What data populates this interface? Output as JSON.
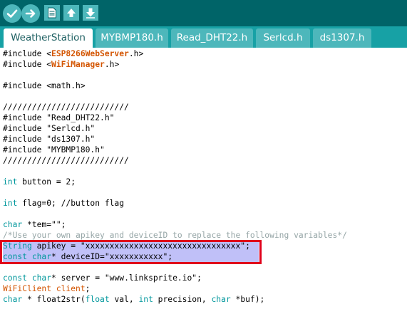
{
  "toolbar": {
    "buttons": [
      {
        "name": "verify-button",
        "icon": "checkmark-icon"
      },
      {
        "name": "upload-button",
        "icon": "arrow-right-icon"
      },
      {
        "name": "new-button",
        "icon": "document-icon"
      },
      {
        "name": "open-button",
        "icon": "arrow-up-icon"
      },
      {
        "name": "save-button",
        "icon": "arrow-down-icon"
      }
    ],
    "colors": {
      "bar": "#006468",
      "button": "#4db7bb"
    }
  },
  "tabs": [
    {
      "label": "WeatherStation",
      "active": true
    },
    {
      "label": "MYBMP180.h",
      "active": false
    },
    {
      "label": "Read_DHT22.h",
      "active": false
    },
    {
      "label": "Serlcd.h",
      "active": false
    },
    {
      "label": "ds1307.h",
      "active": false
    }
  ],
  "code": {
    "lines": [
      {
        "parts": [
          {
            "t": "#include <",
            "c": "plain"
          },
          {
            "t": "ESP8266WebServer",
            "c": "lib"
          },
          {
            "t": ".h>",
            "c": "plain"
          }
        ]
      },
      {
        "parts": [
          {
            "t": "#include <",
            "c": "plain"
          },
          {
            "t": "WiFiManager",
            "c": "lib"
          },
          {
            "t": ".h>",
            "c": "plain"
          }
        ]
      },
      {
        "parts": []
      },
      {
        "parts": [
          {
            "t": "#include <math.h>",
            "c": "plain"
          }
        ]
      },
      {
        "parts": []
      },
      {
        "parts": [
          {
            "t": "//////////////////////////",
            "c": "plain"
          }
        ]
      },
      {
        "parts": [
          {
            "t": "#include \"Read_DHT22.h\"",
            "c": "plain"
          }
        ]
      },
      {
        "parts": [
          {
            "t": "#include \"Serlcd.h\"",
            "c": "plain"
          }
        ]
      },
      {
        "parts": [
          {
            "t": "#include \"ds1307.h\"",
            "c": "plain"
          }
        ]
      },
      {
        "parts": [
          {
            "t": "#include \"MYBMP180.h\"",
            "c": "plain"
          }
        ]
      },
      {
        "parts": [
          {
            "t": "//////////////////////////",
            "c": "plain"
          }
        ]
      },
      {
        "parts": []
      },
      {
        "parts": [
          {
            "t": "int",
            "c": "kw"
          },
          {
            "t": " button = 2;",
            "c": "plain"
          }
        ]
      },
      {
        "parts": []
      },
      {
        "parts": [
          {
            "t": "int",
            "c": "kw"
          },
          {
            "t": " flag=0; //button flag",
            "c": "plain"
          }
        ]
      },
      {
        "parts": []
      },
      {
        "parts": [
          {
            "t": "char",
            "c": "kw"
          },
          {
            "t": " *tem=\"\";",
            "c": "plain"
          }
        ]
      },
      {
        "parts": [
          {
            "t": "/*Use your own apikey and deviceID to replace the following variables*/",
            "c": "cmt"
          }
        ]
      },
      {
        "parts": [
          {
            "t": "String",
            "c": "kw"
          },
          {
            "t": " apikey = \"xxxxxxxxxxxxxxxxxxxxxxxxxxxxxxxx\";",
            "c": "plain"
          }
        ]
      },
      {
        "parts": [
          {
            "t": "const",
            "c": "kw"
          },
          {
            "t": " ",
            "c": "plain"
          },
          {
            "t": "char",
            "c": "kw"
          },
          {
            "t": "* deviceID=\"xxxxxxxxxxx\";",
            "c": "plain"
          }
        ]
      },
      {
        "parts": []
      },
      {
        "parts": [
          {
            "t": "const",
            "c": "kw"
          },
          {
            "t": " ",
            "c": "plain"
          },
          {
            "t": "char",
            "c": "kw"
          },
          {
            "t": "* server = \"www.linksprite.io\";",
            "c": "plain"
          }
        ]
      },
      {
        "parts": [
          {
            "t": "WiFiClient",
            "c": "obj"
          },
          {
            "t": " ",
            "c": "plain"
          },
          {
            "t": "client",
            "c": "obj"
          },
          {
            "t": ";",
            "c": "plain"
          }
        ]
      },
      {
        "parts": [
          {
            "t": "char",
            "c": "kw"
          },
          {
            "t": " * float2str(",
            "c": "plain"
          },
          {
            "t": "float",
            "c": "kw"
          },
          {
            "t": " val, ",
            "c": "plain"
          },
          {
            "t": "int",
            "c": "kw"
          },
          {
            "t": " precision, ",
            "c": "plain"
          },
          {
            "t": "char",
            "c": "kw"
          },
          {
            "t": " *buf);",
            "c": "plain"
          }
        ]
      }
    ]
  },
  "colors": {
    "keyword": "#00979c",
    "library": "#d35400",
    "comment": "#95a5a6",
    "selection": "#c0c0f8",
    "annotation": "#e0001b"
  }
}
